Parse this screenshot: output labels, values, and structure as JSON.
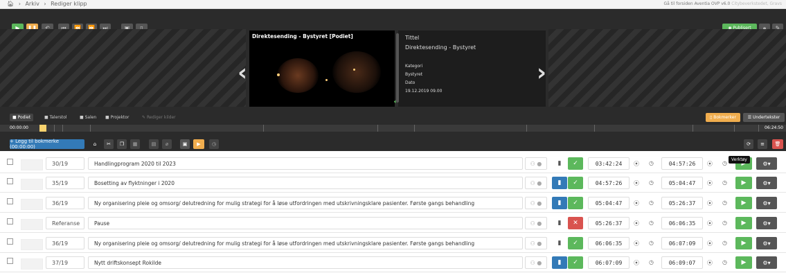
{
  "breadcrumb": {
    "home_icon": "home-icon",
    "items": [
      "Arkiv",
      "Rediger klipp"
    ],
    "sep": "›"
  },
  "topright": {
    "text": "Gå til forsiden",
    "product": "Aventia OVP v6.0",
    "faded": "Citybeverkstedet, Gravs"
  },
  "toolbar": {
    "published": "Publisert"
  },
  "player": {
    "video_title": "Direktesending - Bystyret [Podiet]",
    "meta_title_label": "Tittel",
    "meta_title": "Direktesending - Bystyret",
    "category_label": "Kategori",
    "category": "Bystyret",
    "date_label": "Dato",
    "date": "19.12.2019 09.00"
  },
  "cameras": [
    "Podiet",
    "Talerstol",
    "Salen",
    "Projektor",
    "Rediger kilder"
  ],
  "right_buttons": {
    "bookmarks": "Bokmerker",
    "subtitles": "Undertekster"
  },
  "timeline": {
    "start": "00:00:00",
    "end": "06:24:50"
  },
  "add_bookmark": "+ Legg til bokmerke (00:00:00)",
  "tooltip": "Verktøy",
  "rows": [
    {
      "num": "30/19",
      "title": "Handlingprogram 2020 til 2023",
      "start": "03:42:24",
      "end": "04:57:26",
      "status": "ok",
      "blue": false
    },
    {
      "num": "35/19",
      "title": "Bosetting av flyktninger i 2020",
      "start": "04:57:26",
      "end": "05:04:47",
      "status": "ok",
      "blue": true
    },
    {
      "num": "36/19",
      "title": "Ny organisering pleie og omsorg/ delutredning for mulig strategi for å løse utfordringen med utskrivningsklare pasienter. Første gangs behandling",
      "start": "05:04:47",
      "end": "05:26:37",
      "status": "ok",
      "blue": true
    },
    {
      "num": "Referanse",
      "title": "Pause",
      "start": "05:26:37",
      "end": "06:06:35",
      "status": "no",
      "blue": false
    },
    {
      "num": "36/19",
      "title": "Ny organisering pleie og omsorg/ delutredning for mulig strategi for å løse utfordringen med utskrivningsklare pasienter. Første gangs behandling",
      "start": "06:06:35",
      "end": "06:07:09",
      "status": "ok",
      "blue": false
    },
    {
      "num": "37/19",
      "title": "Nytt driftskonsept Rokilde",
      "start": "06:07:09",
      "end": "06:09:07",
      "status": "ok",
      "blue": true
    }
  ]
}
